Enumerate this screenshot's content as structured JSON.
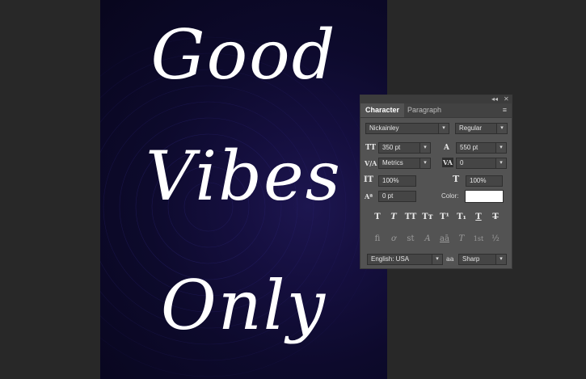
{
  "canvas": {
    "lines": [
      "Good",
      "Vibes",
      "Only"
    ]
  },
  "panel": {
    "top_icons": {
      "collapse": "◂◂",
      "close": "✕"
    },
    "tabs": [
      {
        "label": "Character",
        "active": true
      },
      {
        "label": "Paragraph",
        "active": false
      }
    ],
    "menu_icon": "≡",
    "font_family": "Nickainley",
    "font_style": "Regular",
    "font_size": "350 pt",
    "leading": "550 pt",
    "kerning": "Metrics",
    "tracking": "0",
    "vertical_scale": "100%",
    "horizontal_scale": "100%",
    "baseline_shift": "0 pt",
    "color_label": "Color:",
    "color_value": "#ffffff",
    "type_buttons": [
      "T",
      "T",
      "TT",
      "Tт",
      "T¹",
      "T₁",
      "T",
      "T"
    ],
    "opentype_buttons": [
      "fi",
      "ơ",
      "st",
      "A",
      "aā",
      "T",
      "1st",
      "½"
    ],
    "language": "English: USA",
    "aa_icon": "aa",
    "antialias": "Sharp",
    "icons": {
      "size": "TT",
      "leading": "A",
      "kerning": "V/A",
      "tracking": "VA",
      "vscale": "IT",
      "hscale": "T",
      "baseline": "Aª"
    }
  }
}
